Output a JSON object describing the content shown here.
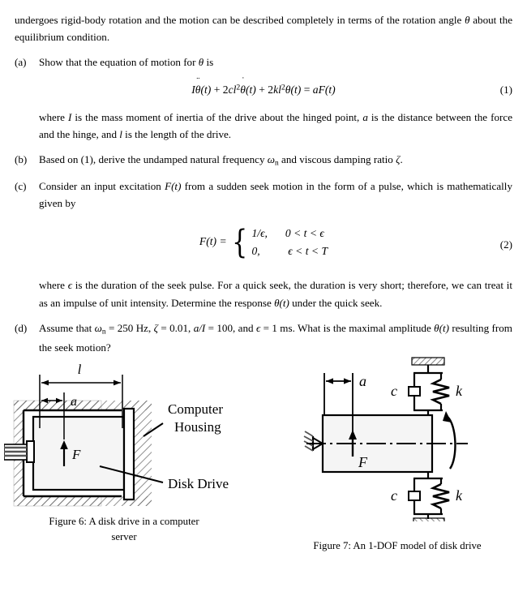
{
  "document": {
    "intro": {
      "text": "undergoes rigid-body rotation and the motion can be described completely in terms of the rotation angle θ about the equilibrium condition."
    },
    "items": [
      {
        "label": "(a)",
        "text": "Show that the equation of motion for θ is"
      },
      {
        "label": "(b)",
        "text": "Based on (1), derive the undamped natural frequency ωn and viscous damping ratio ζ."
      },
      {
        "label": "(c)",
        "text": "Consider an input excitation F(t) from a sudden seek motion in the form of a pulse, which is mathematically given by"
      },
      {
        "label": "(d)",
        "text": "Assume that ωn = 250 Hz, ζ = 0.01, a/I = 100, and ϵ = 1 ms. What is the maximal amplitude θ(t) resulting from the seek motion?"
      }
    ],
    "equation1": {
      "number": "(1)",
      "inertia_symbol": "I",
      "theta": "θ",
      "ddot": "¨",
      "dot": "˙",
      "term_damping_coeff": "2",
      "damping_symbol": "c",
      "length_symbol": "l",
      "exponent": "2",
      "term_stiffness_coeff": "2",
      "stiffness_symbol": "k",
      "rhs_coeff": "a",
      "force_symbol": "F",
      "time": "t",
      "latex": "Iθ̈(t) + 2cl²θ̇(t) + 2kl²θ(t) = aF(t)"
    },
    "eq1_after": {
      "text": "where I is the mass moment of inertia of the drive about the hinged point, a is the distance between the force and the hinge, and l is the length of the drive."
    },
    "equation2": {
      "number": "(2)",
      "lhs": "F(t) =",
      "row1_value": "1/ϵ,",
      "row1_condition": "0 < t < ϵ",
      "row2_value": "0,",
      "row2_condition": "ϵ < t < T"
    },
    "eq2_after": {
      "text": "where ϵ is the duration of the seek pulse. For a quick seek, the duration is very short; therefore, we can treat it as an impulse of unit intensity. Determine the response θ(t) under the quick seek."
    }
  },
  "figures": {
    "figure6": {
      "caption_line1": "Figure 6: A  disk  drive  in  a  computer",
      "caption_line2": "server",
      "labels": {
        "length": "l",
        "offset": "a",
        "force": "F",
        "housing_line1": "Computer",
        "housing_line2": "Housing",
        "drive": "Disk Drive"
      }
    },
    "figure7": {
      "caption": "Figure 7: An 1-DOF model of disk drive",
      "labels": {
        "offset": "a",
        "force": "F",
        "damper_top": "c",
        "spring_top": "k",
        "damper_bottom": "c",
        "spring_bottom": "k"
      }
    }
  },
  "colors": {
    "ink": "#000000",
    "page": "#ffffff",
    "block_fill": "#f5f5f5",
    "hatch": "#6d6d6d"
  }
}
